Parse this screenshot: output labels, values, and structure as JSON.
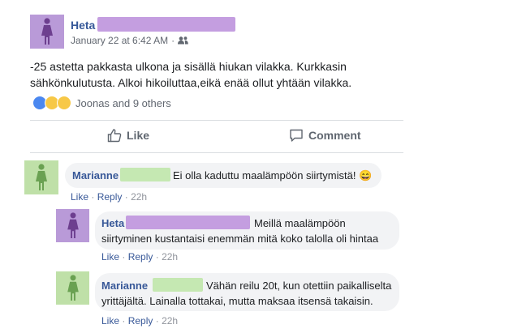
{
  "post": {
    "author": "Heta",
    "date": "January 22 at 6:42 AM",
    "dot": "·",
    "audience_icon": "friends-icon",
    "text_line1": "-25 astetta pakkasta ulkona ja sisällä hiukan vilakka. Kurkkasin",
    "text_line2": "sähkönkulutusta. Alkoi hikoiluttaa,eikä enää ollut yhtään vilakka.",
    "reactions_text": "Joonas and 9 others",
    "like_label": "Like",
    "comment_label": "Comment"
  },
  "comments": [
    {
      "author": "Marianne",
      "text": "Ei olla kaduttu maalämpöön siirtymistä! 😄",
      "like": "Like",
      "reply": "Reply",
      "time": "22h"
    },
    {
      "author": "Heta",
      "text_line1": "Meillä maalämpöön",
      "text_line2": "siirtyminen kustantaisi enemmän mitä koko talolla oli hintaa",
      "like": "Like",
      "reply": "Reply",
      "time": "22h"
    },
    {
      "author": "Marianne",
      "text_line1": "Vähän reilu 20t, kun otettiin paikalliselta",
      "text_line2": "yrittäjältä. Lainalla tottakai, mutta maksaa itsensä takaisin.",
      "like": "Like",
      "reply": "Reply",
      "time": "22h"
    }
  ],
  "colors": {
    "name_blue": "#365899",
    "avatar_purple": "#b99ad8",
    "avatar_green": "#bfe0a8",
    "bubble_gray": "#f2f3f5"
  }
}
